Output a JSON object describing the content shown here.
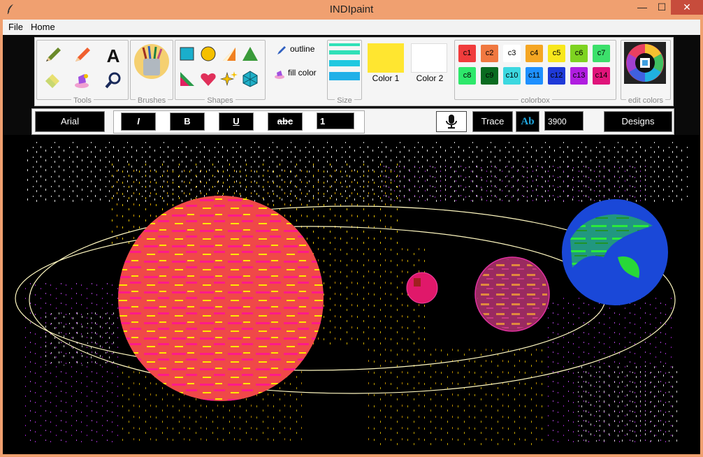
{
  "window": {
    "title": "INDIpaint",
    "minimize": "—",
    "maximize": "☐",
    "close": "✕"
  },
  "menu": [
    "File",
    "Home"
  ],
  "ribbon": {
    "tools_label": "Tools",
    "brushes_label": "Brushes",
    "shapes_label": "Shapes",
    "outline_label": "outline",
    "fill_label": "fill color",
    "size_label": "Size",
    "color1_label": "Color 1",
    "color2_label": "Color 2",
    "color1": "#ffe630",
    "color2": "#ffffff",
    "colorbox_label": "colorbox",
    "edit_colors_label": "edit colors",
    "swatches": [
      {
        "label": "c1",
        "color": "#f03c3c"
      },
      {
        "label": "c2",
        "color": "#f07840"
      },
      {
        "label": "c3",
        "color": "#ffffff"
      },
      {
        "label": "c4",
        "color": "#f5a623"
      },
      {
        "label": "c5",
        "color": "#f8e71c"
      },
      {
        "label": "c6",
        "color": "#7ed321"
      },
      {
        "label": "c7",
        "color": "#3ce06b"
      },
      {
        "label": "c8",
        "color": "#2ee86b"
      },
      {
        "label": "c9",
        "color": "#0a6b20"
      },
      {
        "label": "c10",
        "color": "#3cd8e0"
      },
      {
        "label": "c11",
        "color": "#1e90ff"
      },
      {
        "label": "c12",
        "color": "#1f3ad8"
      },
      {
        "label": "c13",
        "color": "#b01ee0"
      },
      {
        "label": "c14",
        "color": "#e0147a"
      }
    ]
  },
  "fontbar": {
    "font": "Arial",
    "italic": "I",
    "bold": "B",
    "underline": "U",
    "strike": "abc",
    "size_value": "1",
    "trace": "Trace",
    "ab": "Ab",
    "value2": "3900",
    "designs": "Designs"
  }
}
